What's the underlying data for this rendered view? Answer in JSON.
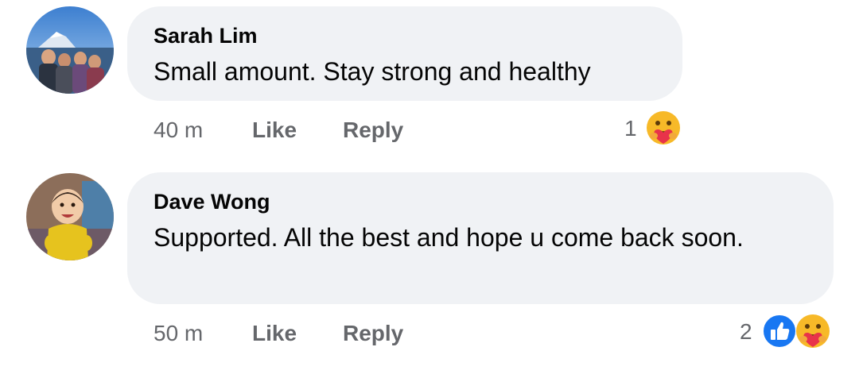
{
  "comments": [
    {
      "author": "Sarah Lim",
      "text": "Small amount. Stay strong and healthy",
      "time": "40 m",
      "like_label": "Like",
      "reply_label": "Reply",
      "reaction_count": "1",
      "reactions": [
        "care-icon"
      ],
      "avatar": "group-photo-mountain-lake"
    },
    {
      "author": "Dave Wong",
      "text": "Supported. All the best and hope u come back soon.",
      "time": "50 m",
      "like_label": "Like",
      "reply_label": "Reply",
      "reaction_count": "2",
      "reactions": [
        "like-icon",
        "care-icon"
      ],
      "avatar": "baby-photo"
    }
  ],
  "colors": {
    "bubble_bg": "#f0f2f5",
    "meta_text": "#65676b",
    "like_blue": "#1877f2",
    "care_yellow": "#f7b928"
  }
}
